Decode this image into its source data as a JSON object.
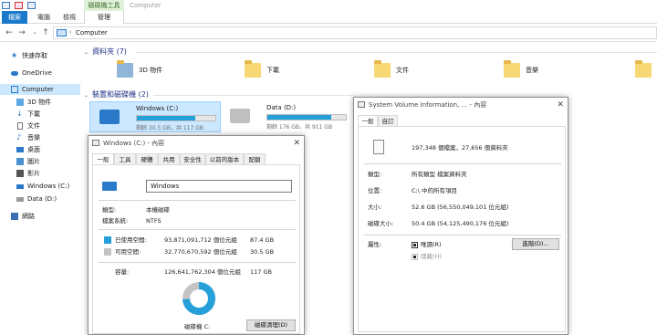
{
  "ribbon": {
    "tabs": [
      "檔案",
      "電腦",
      "檢視"
    ],
    "context_group": "磁碟機工具",
    "context_tab": "管理",
    "window_title": "Computer"
  },
  "address": {
    "path": "Computer"
  },
  "sidebar": {
    "items": [
      {
        "label": "快速存取",
        "icon": "star-icon"
      },
      {
        "label": "OneDrive",
        "icon": "cloud-icon"
      },
      {
        "label": "Computer",
        "icon": "computer-icon",
        "selected": true
      },
      {
        "label": "3D 物件",
        "icon": "cube-icon"
      },
      {
        "label": "下載",
        "icon": "download-icon"
      },
      {
        "label": "文件",
        "icon": "document-icon"
      },
      {
        "label": "音樂",
        "icon": "music-icon"
      },
      {
        "label": "桌面",
        "icon": "desktop-icon"
      },
      {
        "label": "圖片",
        "icon": "picture-icon"
      },
      {
        "label": "影片",
        "icon": "video-icon"
      },
      {
        "label": "Windows (C:)",
        "icon": "drive-icon"
      },
      {
        "label": "Data (D:)",
        "icon": "drive-icon"
      },
      {
        "label": "網路",
        "icon": "network-icon"
      }
    ]
  },
  "main": {
    "folders_header": "資料夾 (7)",
    "folders": [
      "3D 物件",
      "下載",
      "文件",
      "音樂"
    ],
    "drives_header": "裝置和磁碟機 (2)",
    "drives": [
      {
        "name": "Windows (C:)",
        "free_text": "剩餘 30.5 GB，共 117 GB",
        "used_fraction": 0.74
      },
      {
        "name": "Data (D:)",
        "free_text": "剩餘 176 GB，共 911 GB",
        "used_fraction": 0.81
      }
    ]
  },
  "dialog_c": {
    "title": "Windows (C:) - 內容",
    "tabs": [
      "一般",
      "工具",
      "硬體",
      "共用",
      "安全性",
      "以前的版本",
      "配額"
    ],
    "volume_label": "Windows",
    "type_label": "類型:",
    "type_value": "本機磁碟",
    "fs_label": "檔案系統:",
    "fs_value": "NTFS",
    "used_label": "已使用空間:",
    "used_bytes": "93,871,091,712 個位元組",
    "used_gb": "87.4 GB",
    "free_label": "可用空間:",
    "free_bytes": "32,770,670,592 個位元組",
    "free_gb": "30.5 GB",
    "cap_label": "容量:",
    "cap_bytes": "126,641,762,304 個位元組",
    "cap_gb": "117 GB",
    "drive_caption": "磁碟機 C:",
    "cleanup_button": "磁碟清理(D)",
    "used_color": "#26a0da",
    "free_color": "#c4c4c4",
    "used_fraction": 0.741
  },
  "dialog_svi": {
    "title": "System Volume Information, ... - 內容",
    "tabs": [
      "一般",
      "自訂"
    ],
    "summary": "197,348 個檔案，27,656 個資料夾",
    "type_label": "類型:",
    "type_value": "所有類型 檔案資料夾",
    "loc_label": "位置:",
    "loc_value": "C:\\ 中的所有項目",
    "size_label": "大小:",
    "size_value": "52.6 GB (56,550,049,101 位元組)",
    "disk_label": "磁碟大小:",
    "disk_value": "50.4 GB (54,125,490,176 位元組)",
    "attr_label": "屬性:",
    "readonly_label": "唯讀(R)",
    "hidden_label": "隱藏(H)",
    "advanced_button": "進階(D)..."
  }
}
